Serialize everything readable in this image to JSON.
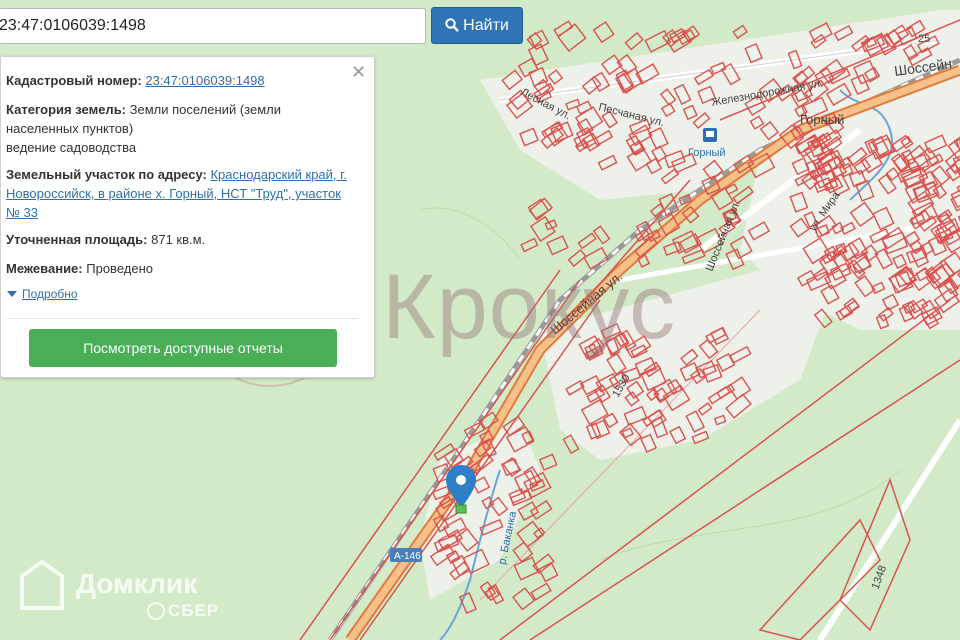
{
  "search": {
    "value": "23:47:0106039:1498",
    "button_label": "Найти"
  },
  "info_panel": {
    "cadastral_label": "Кадастровый номер:",
    "cadastral_value": "23:47:0106039:1498",
    "category_label": "Категория земель:",
    "category_value_1": "Земли поселений (земли",
    "category_value_2": "населенных пунктов)",
    "category_value_3": "ведение садоводства",
    "address_label": "Земельный участок по адресу:",
    "address_value_1": "Краснодарский край, г.",
    "address_value_2": "Новороссийск, в районе х. Горный, НСТ \"Труд\", участок",
    "address_value_3": "№ 33",
    "area_label": "Уточненная площадь:",
    "area_value": "871 кв.м.",
    "survey_label": "Межевание:",
    "survey_value": "Проведено",
    "more_label": "Подробно",
    "reports_button": "Посмотреть доступные отчеты"
  },
  "map": {
    "labels": {
      "peschanaya": "Песчаная ул.",
      "lesnaya": "Лесная ул.",
      "zheleznodorozhnaya": "Железнодорожная ул.",
      "shosseynaya_top": "Шоссейн",
      "gorny_village": "Горный",
      "gorny_station": "Горный",
      "mira": "ул. Мира",
      "shosseynaya_mid": "Шоссейная ул.",
      "shosseynaya_vert": "Шоссейная ул.",
      "bakanka": "р. Баканка",
      "highway": "А-146",
      "parcel_1530": "1530",
      "parcel_1348": "1348",
      "road_25": "25"
    }
  },
  "watermarks": {
    "krokus": "Крокус",
    "domclick": "Домклик",
    "sber": "СБЕР"
  },
  "colors": {
    "map_bg": "#d6ebcd",
    "parcel": "#d9534f",
    "road": "#f2a766",
    "button_blue": "#2f75b5",
    "button_green": "#4aae56",
    "link": "#2f6fab"
  }
}
